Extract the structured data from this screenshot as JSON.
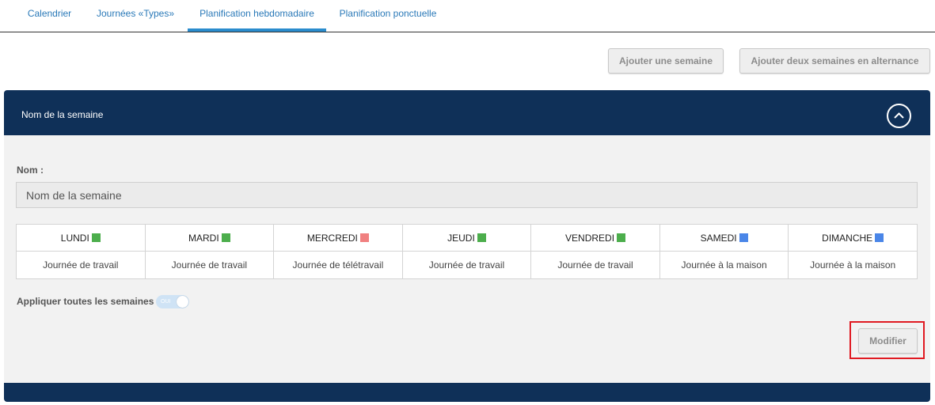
{
  "tabs": [
    {
      "label": "Calendrier"
    },
    {
      "label": "Journées «Types»"
    },
    {
      "label": "Planification hebdomadaire"
    },
    {
      "label": "Planification ponctuelle"
    }
  ],
  "actions": {
    "add_week": "Ajouter une semaine",
    "add_two_weeks": "Ajouter deux semaines en alternance"
  },
  "panel": {
    "title": "Nom de la semaine",
    "collapse_icon": "chevron-up-circle-icon",
    "name_label": "Nom :",
    "name_value": "Nom de la semaine",
    "days": [
      {
        "label": "LUNDI",
        "color": "#4cae4c",
        "type": "Journée de travail"
      },
      {
        "label": "MARDI",
        "color": "#4cae4c",
        "type": "Journée de travail"
      },
      {
        "label": "MERCREDI",
        "color": "#f08080",
        "type": "Journée de télétravail"
      },
      {
        "label": "JEUDI",
        "color": "#4cae4c",
        "type": "Journée de travail"
      },
      {
        "label": "VENDREDI",
        "color": "#4cae4c",
        "type": "Journée de travail"
      },
      {
        "label": "SAMEDI",
        "color": "#4a86e8",
        "type": "Journée à la maison"
      },
      {
        "label": "DIMANCHE",
        "color": "#4a86e8",
        "type": "Journée à la maison"
      }
    ],
    "apply_label": "Appliquer toutes les semaines",
    "apply_toggle_text": "OUI",
    "modify_label": "Modifier"
  },
  "colors": {
    "header_bg": "#0f3058",
    "tab_accent": "#2a8ccd",
    "highlight": "#e01a22"
  }
}
